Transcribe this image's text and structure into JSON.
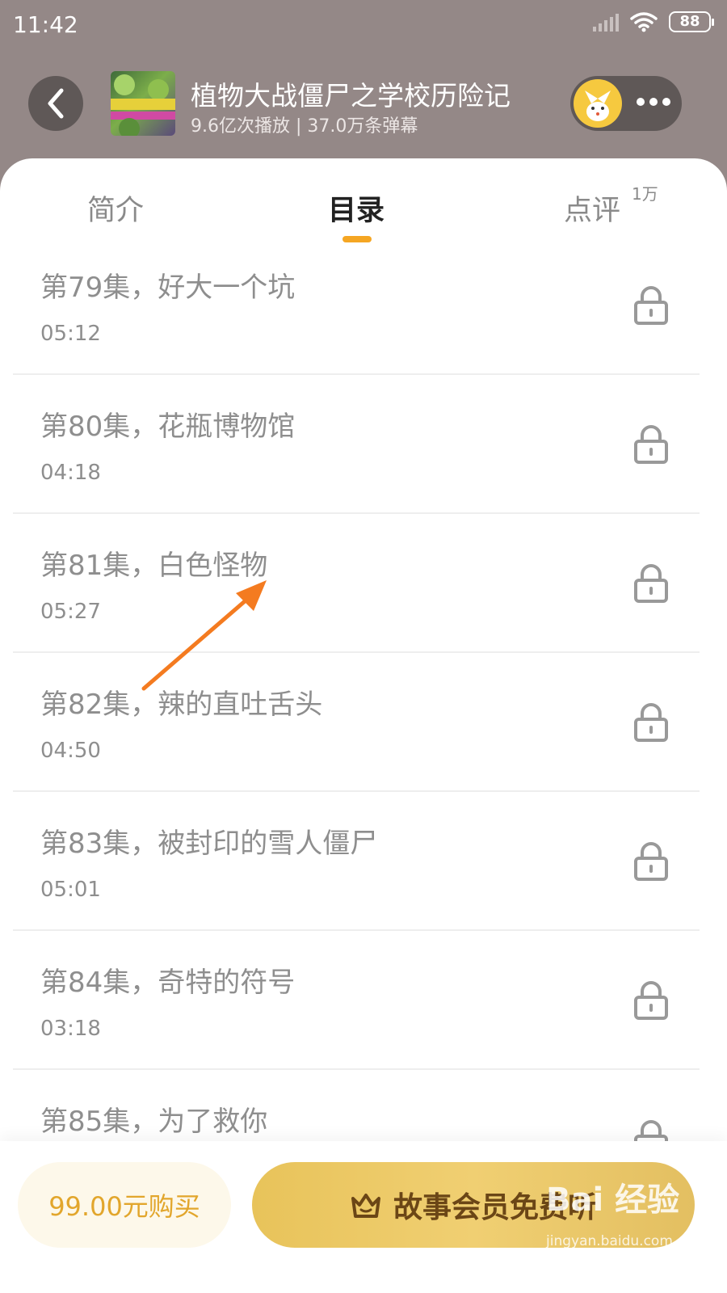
{
  "status_bar": {
    "time": "11:42",
    "battery": "88"
  },
  "header": {
    "title": "植物大战僵尸之学校历险记",
    "stats": "9.6亿次播放 | 37.0万条弹幕"
  },
  "tabs": [
    {
      "label": "简介"
    },
    {
      "label": "目录"
    },
    {
      "label": "点评",
      "badge": "1万"
    }
  ],
  "episodes": [
    {
      "title": "第79集，好大一个坑",
      "duration": "05:12"
    },
    {
      "title": "第80集，花瓶博物馆",
      "duration": "04:18"
    },
    {
      "title": "第81集，白色怪物",
      "duration": "05:27"
    },
    {
      "title": "第82集，辣的直吐舌头",
      "duration": "04:50"
    },
    {
      "title": "第83集，被封印的雪人僵尸",
      "duration": "05:01"
    },
    {
      "title": "第84集，奇特的符号",
      "duration": "03:18"
    },
    {
      "title": "第85集，为了救你",
      "duration": ""
    }
  ],
  "bottom_bar": {
    "buy_label": "99.00元购买",
    "vip_label": "故事会员免费听"
  },
  "watermark": {
    "text": "Bai 经验",
    "sub": "jingyan.baidu.com"
  },
  "colors": {
    "accent": "#f5a623",
    "header_bg": "#948887",
    "vip_gold": "#e8c35a",
    "annotation": "#f47b20"
  }
}
